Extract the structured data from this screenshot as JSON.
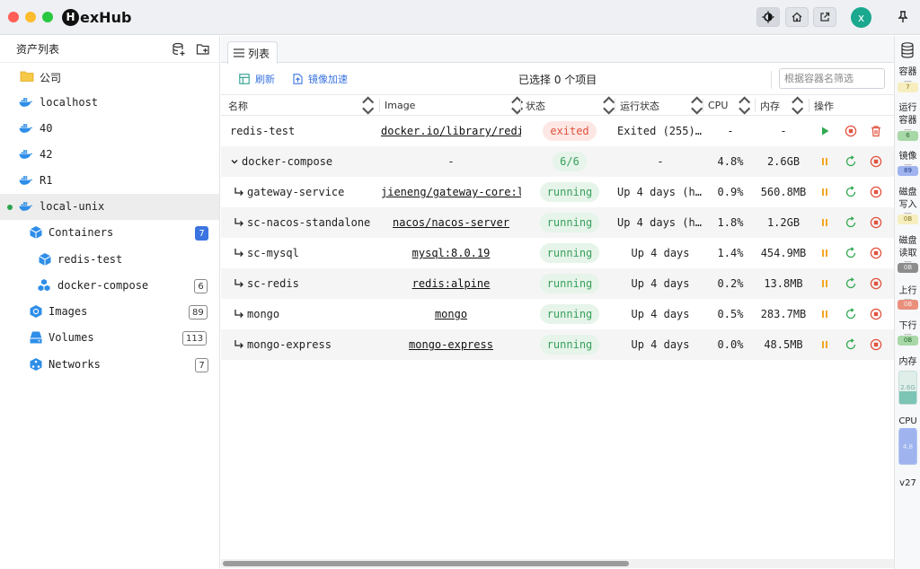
{
  "app": {
    "name": "HexHub",
    "logo_letter": "H",
    "logo_rest": "exHub",
    "user_initial": "x"
  },
  "sidebar": {
    "title": "资产列表",
    "items": [
      {
        "label": "公司",
        "icon": "folder-icon"
      },
      {
        "label": "localhost",
        "icon": "docker-icon"
      },
      {
        "label": "40",
        "icon": "docker-icon"
      },
      {
        "label": "42",
        "icon": "docker-icon"
      },
      {
        "label": "R1",
        "icon": "docker-icon"
      },
      {
        "label": "local-unix",
        "icon": "docker-icon",
        "connected": true
      },
      {
        "label": "Containers",
        "icon": "container-icon",
        "badge": "7"
      },
      {
        "label": "redis-test",
        "icon": "container-icon"
      },
      {
        "label": "docker-compose",
        "icon": "compose-icon",
        "badge": "6"
      },
      {
        "label": "Images",
        "icon": "image-icon",
        "badge": "89"
      },
      {
        "label": "Volumes",
        "icon": "volume-icon",
        "badge": "113"
      },
      {
        "label": "Networks",
        "icon": "network-icon",
        "badge": "7"
      }
    ]
  },
  "main": {
    "tab_label": "列表",
    "toolbar": {
      "refresh_label": "刷新",
      "mirror_label": "镜像加速",
      "selection_text": "已选择 0 个项目",
      "filter_placeholder": "根据容器名筛选"
    },
    "columns": [
      "名称",
      "Image",
      "状态",
      "运行状态",
      "CPU",
      "内存",
      "操作"
    ],
    "rows": [
      {
        "name": "redis-test",
        "image": "docker.io/library/redis",
        "status": "exited",
        "run_state": "Exited (255)…",
        "cpu": "-",
        "mem": "-",
        "actions": [
          "play",
          "stop",
          "delete"
        ]
      },
      {
        "name": "docker-compose",
        "image": "-",
        "status": "6/6",
        "run_state": "-",
        "cpu": "4.8%",
        "mem": "2.6GB",
        "actions": [
          "pause",
          "restart",
          "stop"
        ],
        "group": true
      },
      {
        "name": "gateway-service",
        "image": "jieneng/gateway-core:l",
        "status": "running",
        "run_state": "Up 4 days (h…",
        "cpu": "0.9%",
        "mem": "560.8MB",
        "actions": [
          "pause",
          "restart",
          "stop"
        ]
      },
      {
        "name": "sc-nacos-standalone",
        "image": "nacos/nacos-server",
        "status": "running",
        "run_state": "Up 4 days (h…",
        "cpu": "1.8%",
        "mem": "1.2GB",
        "actions": [
          "pause",
          "restart",
          "stop"
        ]
      },
      {
        "name": "sc-mysql",
        "image": "mysql:8.0.19",
        "status": "running",
        "run_state": "Up 4 days",
        "cpu": "1.4%",
        "mem": "454.9MB",
        "actions": [
          "pause",
          "restart",
          "stop"
        ]
      },
      {
        "name": "sc-redis",
        "image": "redis:alpine",
        "status": "running",
        "run_state": "Up 4 days",
        "cpu": "0.2%",
        "mem": "13.8MB",
        "actions": [
          "pause",
          "restart",
          "stop"
        ]
      },
      {
        "name": "mongo",
        "image": "mongo",
        "status": "running",
        "run_state": "Up 4 days",
        "cpu": "0.5%",
        "mem": "283.7MB",
        "actions": [
          "pause",
          "restart",
          "stop"
        ]
      },
      {
        "name": "mongo-express",
        "image": "mongo-express",
        "status": "running",
        "run_state": "Up 4 days",
        "cpu": "0.0%",
        "mem": "48.5MB",
        "actions": [
          "pause",
          "restart",
          "stop"
        ]
      }
    ]
  },
  "right_panel": {
    "containers_label": "容器",
    "containers_value": "7",
    "running_label": "运行容器",
    "running_value": "6",
    "images_label": "镜像",
    "images_value": "89",
    "disk_write_label": "磁盘写入",
    "disk_write_value": "0B",
    "disk_read_label": "磁盘读取",
    "disk_read_value": "0B",
    "upload_label": "上行",
    "upload_value": "0B",
    "download_label": "下行",
    "download_value": "0B",
    "memory_label": "内存",
    "memory_value": "2.6G",
    "cpu_label": "CPU",
    "cpu_value": "4.8",
    "version": "v27",
    "sep": "—"
  },
  "colors": {
    "accent": "#3b74e0",
    "running": "#38a05a",
    "exited": "#e0533f",
    "pause": "#f5a623",
    "avatar": "#1aa88f"
  }
}
